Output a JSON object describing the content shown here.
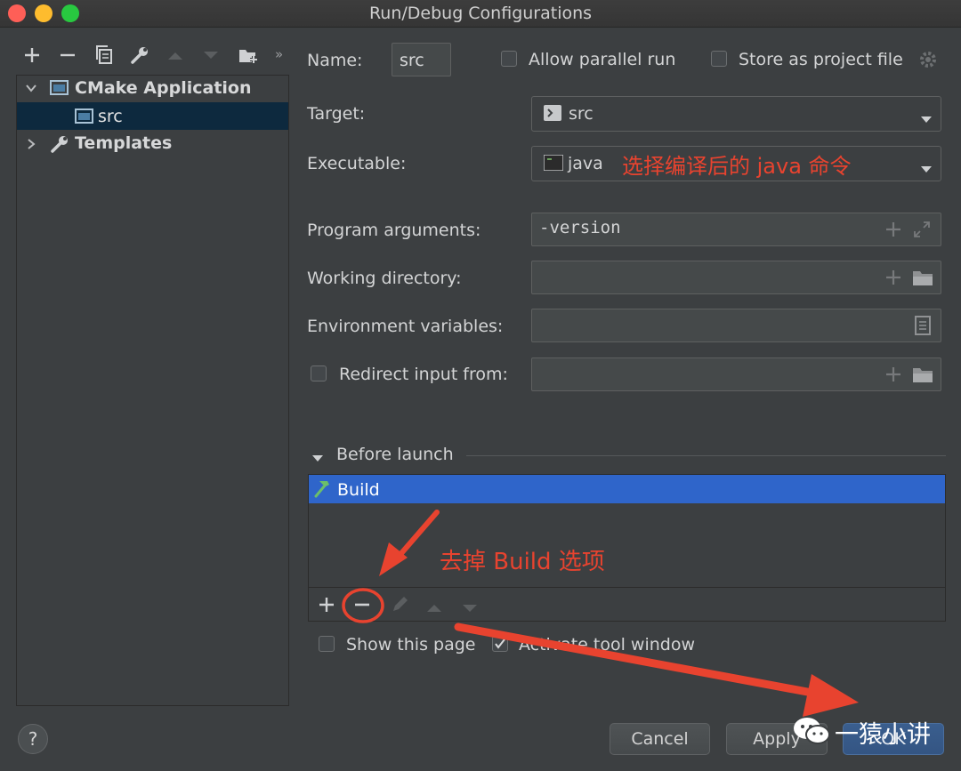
{
  "window": {
    "title": "Run/Debug Configurations"
  },
  "tree": {
    "root_label": "CMake Application",
    "child_label": "src",
    "templates_label": "Templates"
  },
  "form": {
    "name_label": "Name:",
    "name_value": "src",
    "allow_parallel_label": "Allow parallel run",
    "store_project_label": "Store as project file",
    "target_label": "Target:",
    "target_value": "src",
    "executable_label": "Executable:",
    "executable_value": "java",
    "program_args_label": "Program arguments:",
    "program_args_value": "-version",
    "working_dir_label": "Working directory:",
    "env_vars_label": "Environment variables:",
    "redirect_label": "Redirect input from:"
  },
  "before_launch": {
    "header": "Before launch",
    "items": [
      "Build"
    ]
  },
  "footer": {
    "show_page_label": "Show this page",
    "activate_tool_label": "Activate tool window",
    "cancel": "Cancel",
    "apply": "Apply",
    "ok": "OK",
    "help": "?"
  },
  "annotations": {
    "executable_note": "选择编译后的 java 命令",
    "remove_build_note": "去掉 Build 选项",
    "watermark": "一猿小讲"
  },
  "colors": {
    "annotation_red": "#e8432f",
    "selection_blue": "#2f65ca",
    "tree_selection": "#0d293e"
  }
}
